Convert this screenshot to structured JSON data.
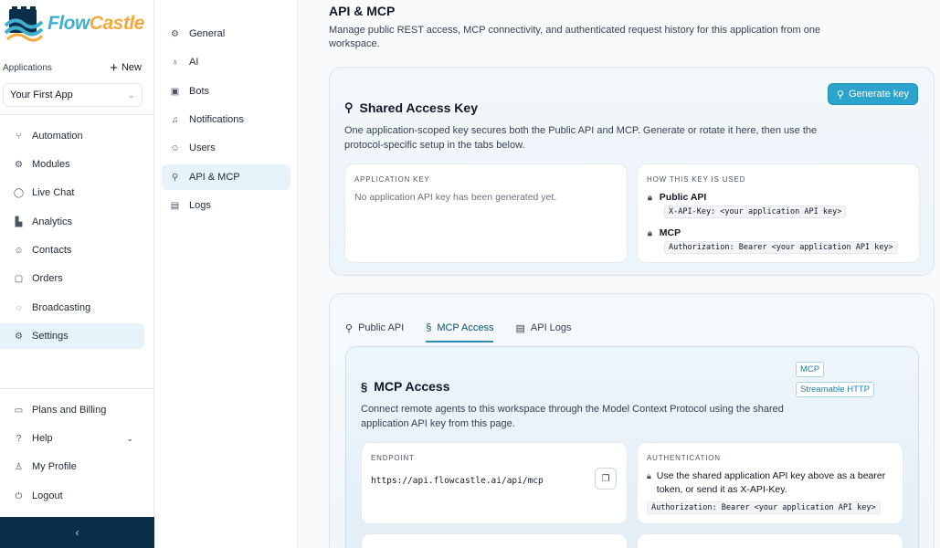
{
  "brand": {
    "name_part1": "Flow",
    "name_part2": "Castle"
  },
  "sidebar": {
    "apps_label": "Applications",
    "new_label": "New",
    "selected_app": "Your First App",
    "items": [
      {
        "label": "Automation",
        "icon": "branch-icon"
      },
      {
        "label": "Modules",
        "icon": "gear-icon"
      },
      {
        "label": "Live Chat",
        "icon": "chat-icon"
      },
      {
        "label": "Analytics",
        "icon": "chart-icon"
      },
      {
        "label": "Contacts",
        "icon": "contacts-icon"
      },
      {
        "label": "Orders",
        "icon": "cart-icon"
      },
      {
        "label": "Broadcasting",
        "icon": "broadcast-icon"
      },
      {
        "label": "Settings",
        "icon": "gear-icon"
      }
    ],
    "bottom_items": [
      {
        "label": "Plans and Billing",
        "icon": "card-icon"
      },
      {
        "label": "Help",
        "icon": "help-icon"
      },
      {
        "label": "My Profile",
        "icon": "user-icon"
      },
      {
        "label": "Logout",
        "icon": "power-icon"
      }
    ],
    "collapse_glyph": "‹"
  },
  "subnav": {
    "items": [
      {
        "label": "General",
        "icon": "gear-icon"
      },
      {
        "label": "AI",
        "icon": "bulb-icon"
      },
      {
        "label": "Bots",
        "icon": "bot-icon"
      },
      {
        "label": "Notifications",
        "icon": "bell-icon"
      },
      {
        "label": "Users",
        "icon": "users-icon"
      },
      {
        "label": "API & MCP",
        "icon": "plug-icon"
      },
      {
        "label": "Logs",
        "icon": "document-icon"
      }
    ]
  },
  "page": {
    "title": "API & MCP",
    "description": "Manage public REST access, MCP connectivity, and authenticated request history for this application from one workspace."
  },
  "shared_key": {
    "generate_label": "Generate key",
    "title": "Shared Access Key",
    "description": "One application-scoped key secures both the Public API and MCP. Generate or rotate it here, then use the protocol-specific setup in the tabs below.",
    "app_key_label": "APPLICATION KEY",
    "app_key_empty": "No application API key has been generated yet.",
    "usage_label": "HOW THIS KEY IS USED",
    "usage": [
      {
        "name": "Public API",
        "code": "X-API-Key: <your application API key>"
      },
      {
        "name": "MCP",
        "code": "Authorization: Bearer <your application API key>"
      }
    ]
  },
  "tabs": [
    {
      "label": "Public API",
      "icon": "plug-icon",
      "active": false
    },
    {
      "label": "MCP Access",
      "icon": "mcp-icon",
      "active": true
    },
    {
      "label": "API Logs",
      "icon": "document-icon",
      "active": false
    }
  ],
  "mcp": {
    "title": "MCP Access",
    "badge_mcp": "MCP",
    "badge_transport": "Streamable HTTP",
    "description": "Connect remote agents to this workspace through the Model Context Protocol using the shared application API key from this page.",
    "endpoint_label": "ENDPOINT",
    "endpoint_url": "https://api.flowcastle.ai/api/mcp",
    "auth_label": "AUTHENTICATION",
    "auth_text": "Use the shared application API key above as a bearer token, or send it as X-API-Key.",
    "auth_code": "Authorization: Bearer <your application API key>"
  },
  "colors": {
    "accent": "#2ba3cc",
    "nav_active": "#e6f3fa",
    "collapse_bar": "#0b2e4a"
  }
}
